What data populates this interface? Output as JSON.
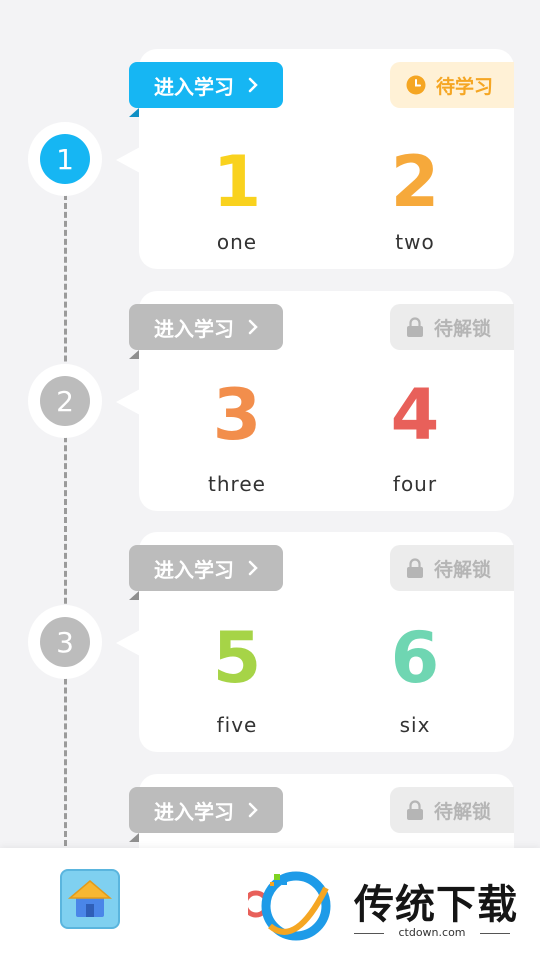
{
  "lessons": [
    {
      "step": "1",
      "active": true,
      "study_label": "进入学习",
      "status_label": "待学习",
      "status_icon": "clock-icon",
      "items": [
        {
          "digit": "1",
          "word": "one",
          "color": "#f9d21e"
        },
        {
          "digit": "2",
          "word": "two",
          "color": "#f6a93b"
        }
      ]
    },
    {
      "step": "2",
      "active": false,
      "study_label": "进入学习",
      "status_label": "待解锁",
      "status_icon": "lock-icon",
      "items": [
        {
          "digit": "3",
          "word": "three",
          "color": "#f28e4c"
        },
        {
          "digit": "4",
          "word": "four",
          "color": "#e8605a"
        }
      ]
    },
    {
      "step": "3",
      "active": false,
      "study_label": "进入学习",
      "status_label": "待解锁",
      "status_icon": "lock-icon",
      "items": [
        {
          "digit": "5",
          "word": "five",
          "color": "#a6d447"
        },
        {
          "digit": "6",
          "word": "six",
          "color": "#6fd6b2"
        }
      ]
    },
    {
      "study_label": "进入学习",
      "status_label": "待解锁",
      "status_icon": "lock-icon"
    }
  ],
  "colors": {
    "active_blue": "#16b6f3",
    "inactive_gray": "#bcbcbc",
    "pending_bg": "#fff1d6",
    "pending_text": "#f5a623",
    "locked_bg": "#ececec",
    "locked_text": "#b5b5b5"
  },
  "bottom_bar": {
    "home_icon": "house-icon",
    "watermark_title": "传统下载",
    "watermark_sub": "ctdown.com"
  }
}
